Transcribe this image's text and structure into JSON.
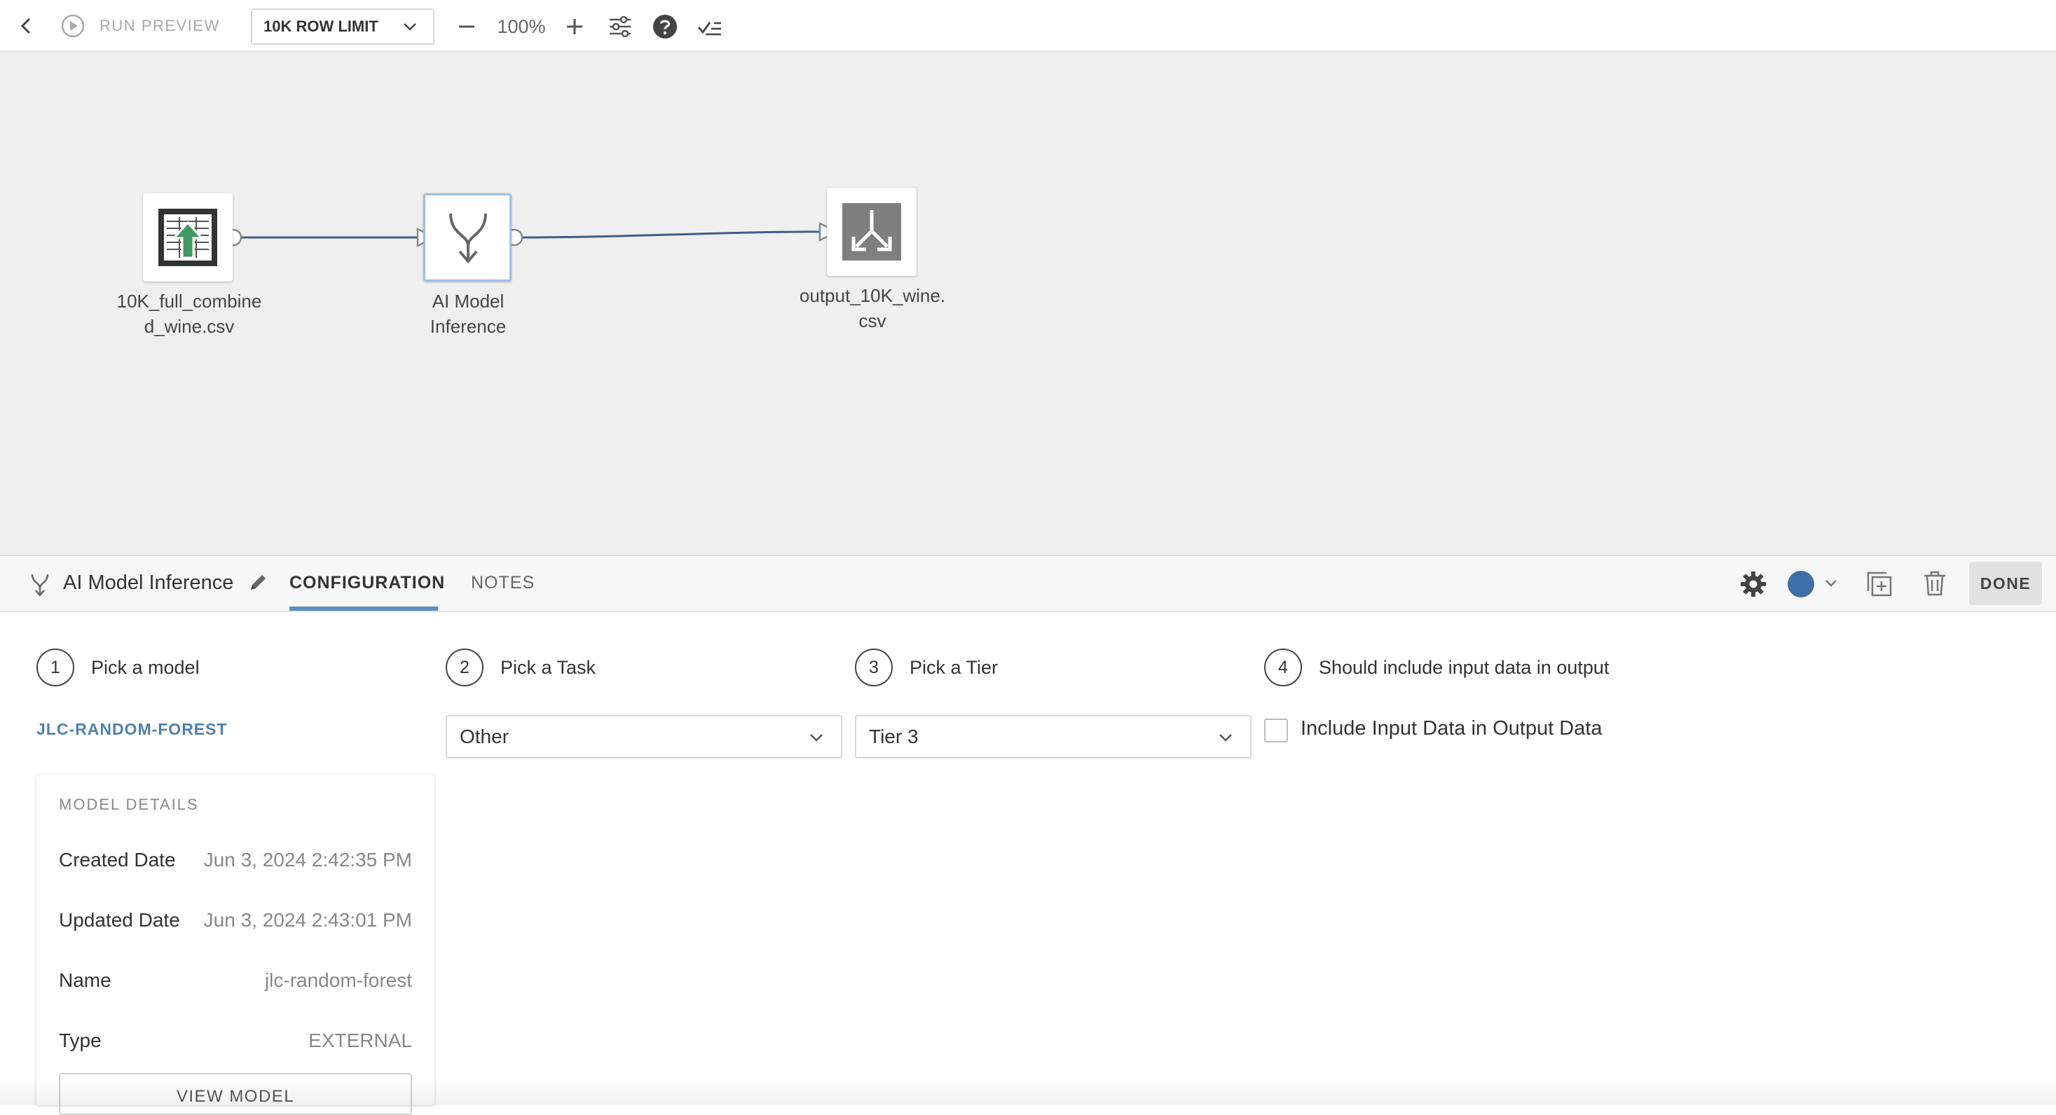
{
  "toolbar": {
    "run_preview_label": "RUN PREVIEW",
    "row_limit_label": "10K ROW LIMIT",
    "zoom_level": "100%"
  },
  "canvas": {
    "nodes": [
      {
        "label_line1": "10K_full_combine",
        "label_line2": "d_wine.csv",
        "icon": "file-upload-icon"
      },
      {
        "label_line1": "AI Model",
        "label_line2": "Inference",
        "icon": "merge-arrow-icon"
      },
      {
        "label_line1": "output_10K_wine.",
        "label_line2": "csv",
        "icon": "output-arrows-icon"
      }
    ]
  },
  "panel": {
    "title": "AI Model Inference",
    "tabs": {
      "configuration": "CONFIGURATION",
      "notes": "NOTES"
    },
    "done_label": "DONE",
    "status_color": "#3e6fa8"
  },
  "steps": [
    {
      "number": "1",
      "label": "Pick a model"
    },
    {
      "number": "2",
      "label": "Pick a Task"
    },
    {
      "number": "3",
      "label": "Pick a Tier"
    },
    {
      "number": "4",
      "label": "Should include input data in output"
    }
  ],
  "model": {
    "link_label": "JLC-RANDOM-FOREST",
    "details_title": "MODEL DETAILS",
    "rows": [
      {
        "key": "Created Date",
        "value": "Jun 3, 2024 2:42:35 PM"
      },
      {
        "key": "Updated Date",
        "value": "Jun 3, 2024 2:43:01 PM"
      },
      {
        "key": "Name",
        "value": "jlc-random-forest"
      },
      {
        "key": "Type",
        "value": "EXTERNAL"
      }
    ],
    "view_button": "VIEW MODEL"
  },
  "task_select": {
    "value": "Other"
  },
  "tier_select": {
    "value": "Tier 3"
  },
  "include_input": {
    "label": "Include Input Data in Output Data",
    "checked": false
  },
  "colors": {
    "accent": "#5b8fc4",
    "link": "#4f7fae",
    "edge": "#3f5f86"
  }
}
